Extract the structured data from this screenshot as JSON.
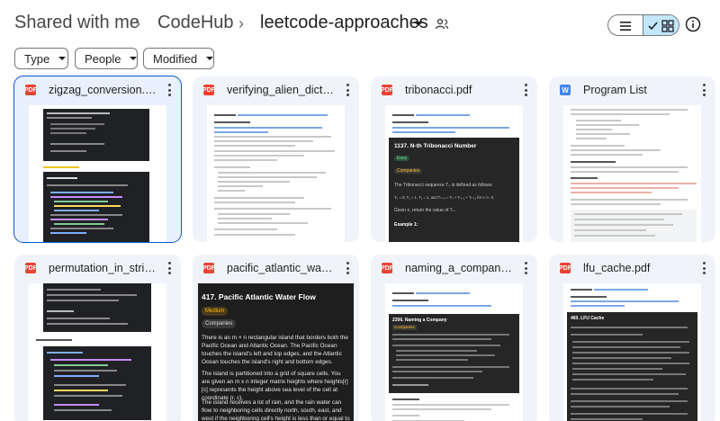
{
  "breadcrumb": {
    "root": "Shared with me",
    "parent": "CodeHub",
    "current": "leetcode-approaches"
  },
  "filters": [
    "Type",
    "People",
    "Modified"
  ],
  "files": [
    {
      "name": "zigzag_conversion.pdf",
      "type": "pdf"
    },
    {
      "name": "verifying_alien_dictionary.pdf",
      "type": "pdf"
    },
    {
      "name": "tribonacci.pdf",
      "type": "pdf"
    },
    {
      "name": "Program List",
      "type": "doc"
    },
    {
      "name": "permutation_in_string.pdf",
      "type": "pdf"
    },
    {
      "name": "pacific_atlantic_water_flow.pdf",
      "type": "pdf"
    },
    {
      "name": "naming_a_company.pdf",
      "type": "pdf"
    },
    {
      "name": "lfu_cache.pdf",
      "type": "pdf"
    }
  ],
  "thumbs": {
    "tribonacci_title": "1137. N-th Tribonacci Number",
    "tribonacci_desc": "The Tribonacci sequence Tₙ is defined as follows:",
    "tribonacci_formula": "T₀ = 0, T₁ = 1, T₂ = 1, and Tₙ₊₃ = Tₙ + Tₙ₊₁ + Tₙ₊₂ for n >= 0.",
    "tribonacci_given": "Given n, return the value of Tₙ.",
    "tribonacci_example": "Example 1:",
    "pacific_title": "417. Pacific Atlantic Water Flow",
    "pacific_medium": "Medium",
    "pacific_companies": "Companies",
    "pacific_p1": "There is an m × n rectangular island that borders both the Pacific Ocean and Atlantic Ocean. The Pacific Ocean touches the island's left and top edges, and the Atlantic Ocean touches the island's right and bottom edges.",
    "pacific_p2": "The island is partitioned into a grid of square cells. You are given an m x n integer matrix heights where heights[r][c] represents the height above sea level of the cell at coordinate (r, c).",
    "pacific_p3": "The island receives a lot of rain, and the rain water can flow to neighboring cells directly north, south, east, and west if the neighboring cell's height is less than or equal to the current cell's height. Water can flow from any cell adjacent to an ocean into the ocean.",
    "naming_title": "2306. Naming a Company",
    "lfu_title": "460. LFU Cache",
    "easy": "Easy",
    "companies": "Companies",
    "example": "Example 1:"
  },
  "colors": {
    "selected_bg": "#e8f0fe",
    "selected_border": "#0b57d0",
    "card_bg": "#f0f4f9",
    "pdf_red": "#ea4335",
    "doc_blue": "#4285f4",
    "toggle_active": "#c2e7ff"
  }
}
